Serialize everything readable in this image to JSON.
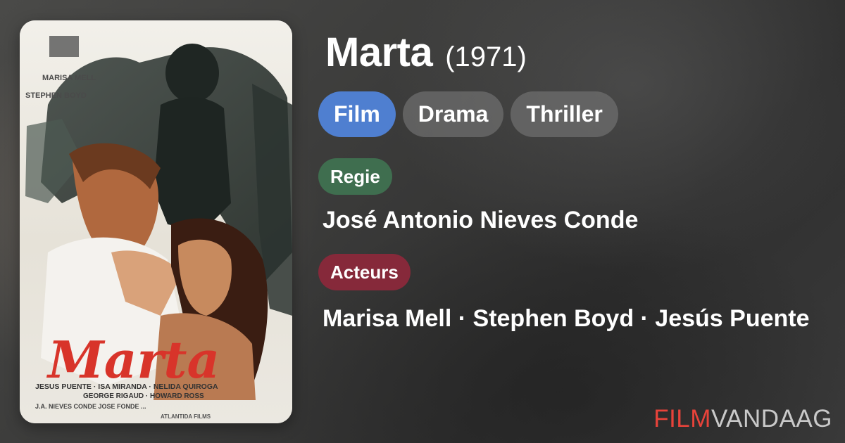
{
  "movie": {
    "title": "Marta",
    "year": "(1971)"
  },
  "genres": [
    "Film",
    "Drama",
    "Thriller"
  ],
  "regie": {
    "label": "Regie",
    "names": "José Antonio Nieves Conde"
  },
  "acteurs": {
    "label": "Acteurs",
    "names": "Marisa Mell · Stephen Boyd · Jesús Puente"
  },
  "brand": {
    "part1": "FILM",
    "part2": "VANDAAG"
  },
  "poster": {
    "top_credits_1": "MARISA MELL",
    "top_credits_2": "STEPHEN BOYD",
    "title": "Marta",
    "cast_line_1": "JESUS PUENTE · ISA MIRANDA · NELIDA QUIROGA",
    "cast_line_2": "GEORGE RIGAUD · HOWARD ROSS",
    "credits_line": "J.A. NIEVES CONDE    JOSE FONDE    ...",
    "studio_line": "ATLANTIDA FILMS"
  },
  "colors": {
    "film_chip": "#4f7fd0",
    "regie_label": "#3f6e4f",
    "acteurs_label": "#86293a",
    "brand_red": "#e8433a"
  }
}
